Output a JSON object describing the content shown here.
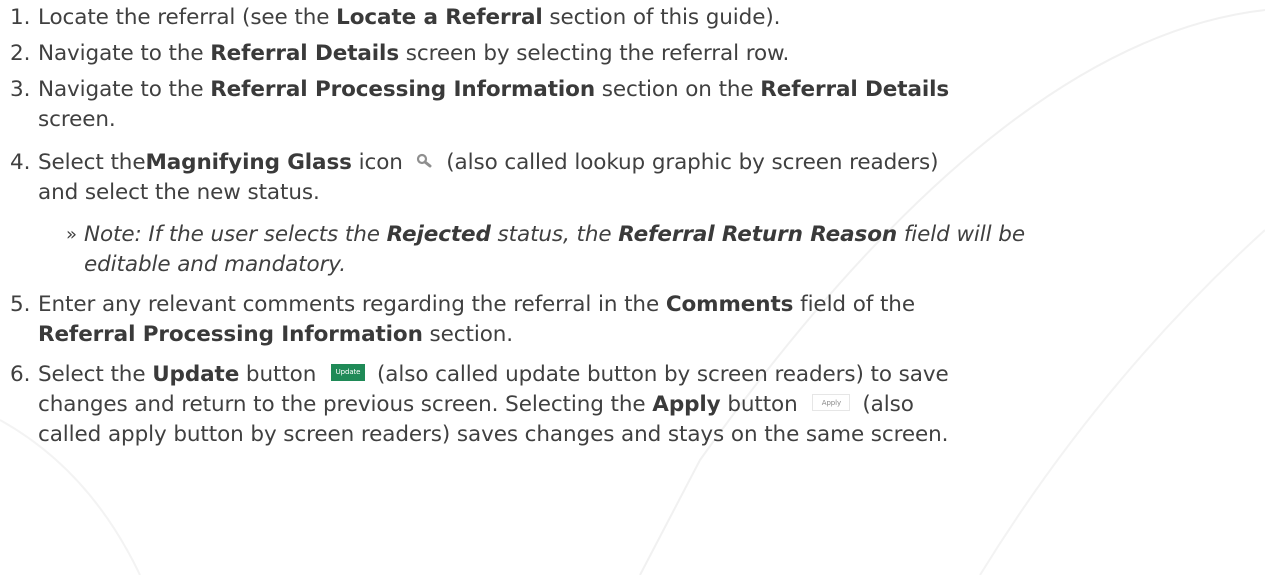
{
  "steps": [
    {
      "num": "1.",
      "t1": "Locate the referral (see the ",
      "b1": "Locate a Referral",
      "t2": " section of this guide)."
    },
    {
      "num": "2.",
      "t1": "Navigate to the ",
      "b1": "Referral Details",
      "t2": " screen by selecting the referral row."
    },
    {
      "num": "3.",
      "t1": "Navigate to the ",
      "b1": "Referral Processing Information",
      "t2": " section on the ",
      "b2": "Referral Details",
      "t3": "screen."
    },
    {
      "num": "4.",
      "t1": "Select the",
      "b1": "Magnifying Glass",
      "t2": " icon ",
      "t3": " (also called lookup graphic by screen readers)",
      "t4": "and select the new status."
    },
    {
      "num": "5.",
      "t1": "Enter any relevant comments regarding the referral in the ",
      "b1": "Comments",
      "t2": " field of the",
      "b2": "Referral Processing Information",
      "t3": " section."
    },
    {
      "num": "6.",
      "t1": "Select the ",
      "b1": "Update",
      "t2": " button ",
      "btn1": "Update",
      "t3": "(also called update button by screen readers) to save",
      "t4": "changes and return to the previous screen. Selecting the ",
      "b2": "Apply",
      "t5": " button ",
      "btn2": "Apply",
      "t6": "(also",
      "t7": "called apply button by screen readers) saves changes and stays on the same screen."
    }
  ],
  "note": {
    "bullet": "»",
    "t1": "Note: If the user selects the ",
    "b1": "Rejected",
    "t2": " status, the ",
    "b2": "Referral Return Reason",
    "t3": " field will be",
    "t4": "editable and mandatory."
  },
  "icons": {
    "lookup": "magnifying-glass-icon"
  },
  "colors": {
    "text": "#404040",
    "update_button": "#1f8a57",
    "apply_button_border": "#e6e6e6"
  }
}
